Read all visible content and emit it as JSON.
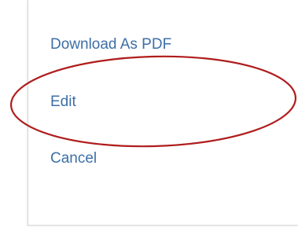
{
  "menu": {
    "items": [
      {
        "label": "Download As PDF"
      },
      {
        "label": "Edit"
      },
      {
        "label": "Cancel"
      }
    ]
  },
  "annotation": {
    "shape": "ellipse",
    "color": "#b01c1c",
    "highlights": "Edit"
  },
  "colors": {
    "link": "#3d6fa6",
    "background": "#ffffff",
    "panel_border": "#d8d8d8"
  }
}
